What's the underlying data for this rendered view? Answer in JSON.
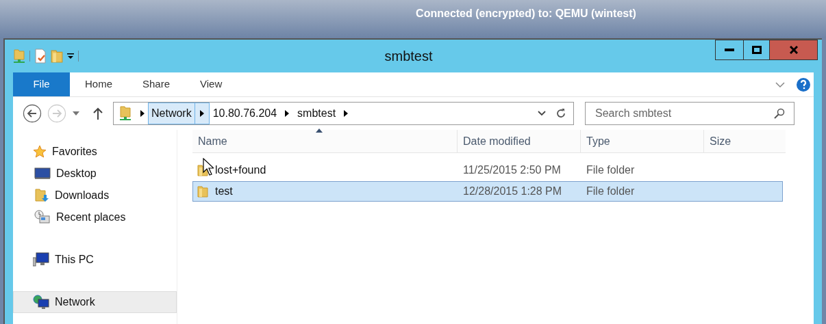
{
  "session_bar": {
    "title": "Connected (encrypted) to: QEMU (wintest)"
  },
  "window": {
    "title": "smbtest"
  },
  "ribbon_tabs": [
    {
      "label": "File",
      "selected": true
    },
    {
      "label": "Home",
      "selected": false
    },
    {
      "label": "Share",
      "selected": false
    },
    {
      "label": "View",
      "selected": false
    }
  ],
  "breadcrumbs": [
    {
      "label": "Network",
      "selected": true
    },
    {
      "label": "10.80.76.204",
      "selected": false
    },
    {
      "label": "smbtest",
      "selected": false
    }
  ],
  "search": {
    "placeholder": "Search smbtest"
  },
  "sidebar": {
    "items": [
      {
        "label": "Favorites",
        "selected": false,
        "children": [
          {
            "label": "Desktop",
            "selected": false
          },
          {
            "label": "Downloads",
            "selected": false
          },
          {
            "label": "Recent places",
            "selected": false
          }
        ]
      },
      {
        "label": "This PC",
        "selected": false
      },
      {
        "label": "Network",
        "selected": true
      }
    ]
  },
  "table": {
    "columns": [
      "Name",
      "Date modified",
      "Type",
      "Size"
    ],
    "rows": [
      {
        "name": "lost+found",
        "date": "11/25/2015 2:50 PM",
        "type": "File folder",
        "selected": false
      },
      {
        "name": "test",
        "date": "12/28/2015 1:28 PM",
        "type": "File folder",
        "selected": true
      }
    ]
  }
}
